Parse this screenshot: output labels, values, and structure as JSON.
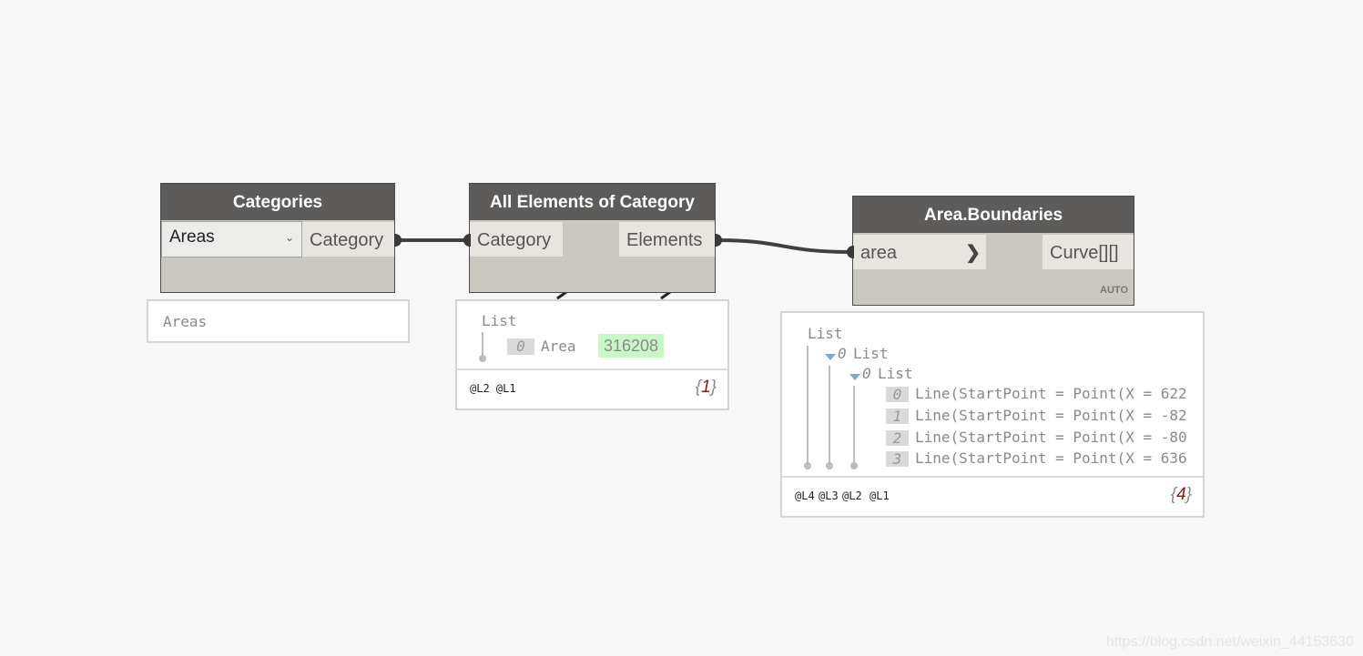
{
  "nodes": {
    "categories": {
      "title": "Categories",
      "dropdown_value": "Areas",
      "output_port": "Category",
      "preview_text": "Areas"
    },
    "all_elements": {
      "title": "All Elements of Category",
      "input_port": "Category",
      "output_port": "Elements",
      "preview": {
        "root_label": "List",
        "items": [
          {
            "index": "0",
            "label": "Area",
            "value": "316208"
          }
        ],
        "levels": "@L2 @L1",
        "count_open": "{",
        "count": "1",
        "count_close": "}"
      }
    },
    "area_boundaries": {
      "title": "Area.Boundaries",
      "input_port": "area",
      "output_port": "Curve[][]",
      "lacing": "AUTO",
      "preview": {
        "root_label": "List",
        "sub1_index": "0",
        "sub1_label": "List",
        "sub2_index": "0",
        "sub2_label": "List",
        "items": [
          {
            "index": "0",
            "text": "Line(StartPoint = Point(X = 622"
          },
          {
            "index": "1",
            "text": "Line(StartPoint = Point(X = -82"
          },
          {
            "index": "2",
            "text": "Line(StartPoint = Point(X = -80"
          },
          {
            "index": "3",
            "text": "Line(StartPoint = Point(X = 636"
          }
        ],
        "levels": [
          "@L4",
          "@L3",
          "@L2",
          "@L1"
        ],
        "count_open": "{",
        "count": "4",
        "count_close": "}"
      }
    }
  },
  "watermark": "https://blog.csdn.net/weixin_44153630"
}
